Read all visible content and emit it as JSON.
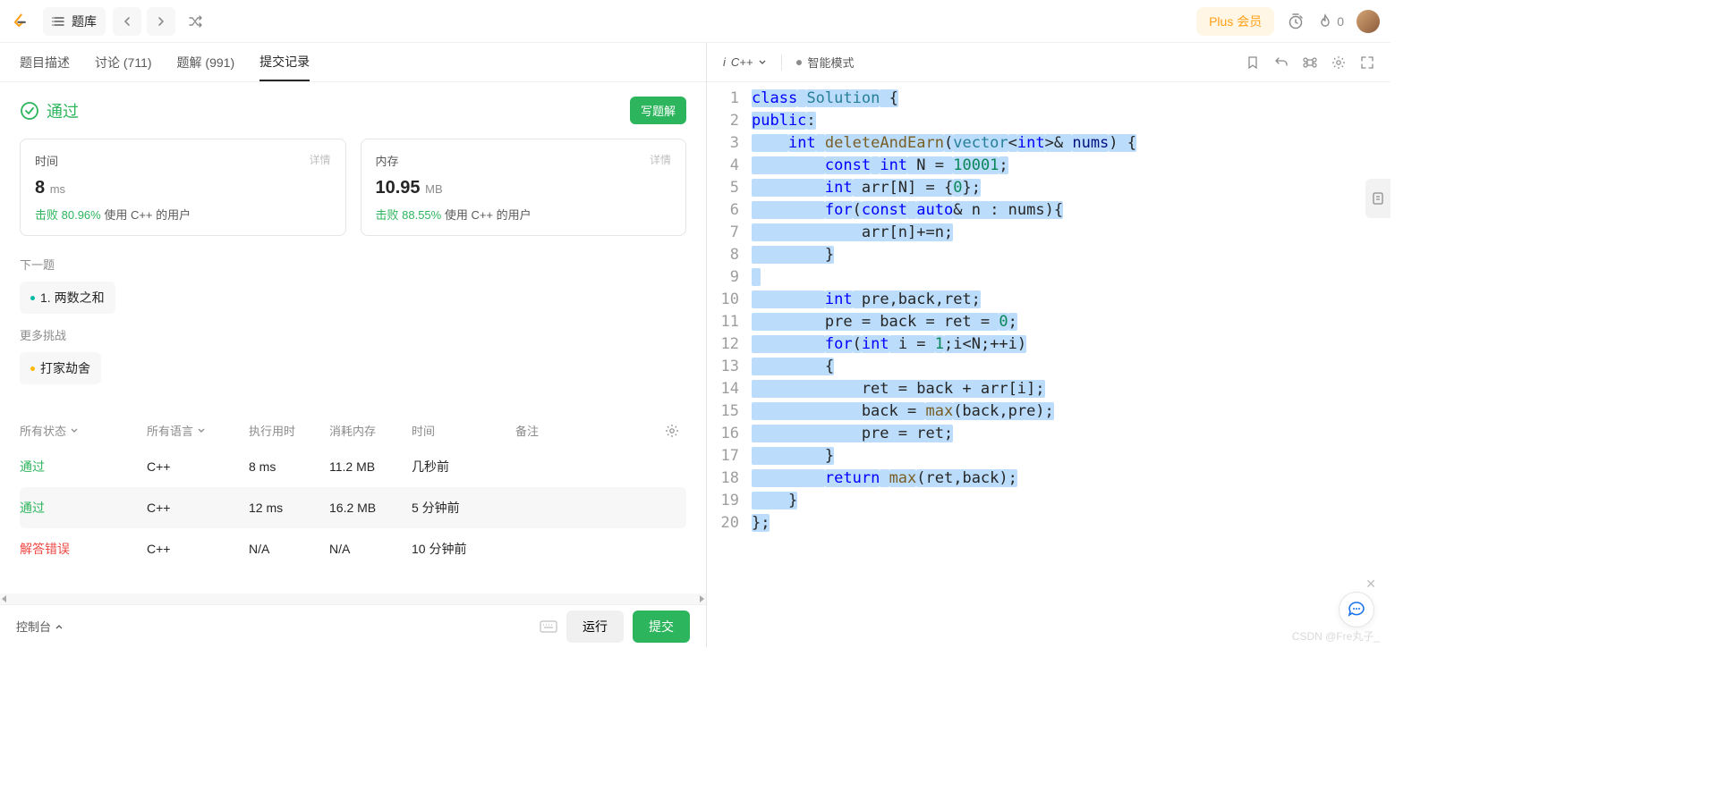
{
  "nav": {
    "problem_list_label": "题库",
    "plus_label": "Plus 会员",
    "fire_count": "0"
  },
  "tabs": {
    "desc": "题目描述",
    "discuss": "讨论 (711)",
    "solutions": "题解 (991)",
    "submissions": "提交记录"
  },
  "result": {
    "status": "通过",
    "write_solution": "写题解",
    "time_label": "时间",
    "mem_label": "内存",
    "detail": "详情",
    "time_value": "8",
    "time_unit": "ms",
    "mem_value": "10.95",
    "mem_unit": "MB",
    "time_beat_prefix": "击败 ",
    "time_beat_pct": "80.96%",
    "time_beat_suffix": " 使用 C++ 的用户",
    "mem_beat_prefix": "击败 ",
    "mem_beat_pct": "88.55%",
    "mem_beat_suffix": " 使用 C++ 的用户"
  },
  "next": {
    "label": "下一题",
    "item": "1. 两数之和"
  },
  "more": {
    "label": "更多挑战",
    "item": "打家劫舍"
  },
  "subhead": {
    "status": "所有状态",
    "lang": "所有语言",
    "runtime": "执行用时",
    "memory": "消耗内存",
    "time": "时间",
    "note": "备注"
  },
  "subs": [
    {
      "status": "通过",
      "statusClass": "status-ok",
      "lang": "C++",
      "runtime": "8 ms",
      "memory": "11.2 MB",
      "time": "几秒前"
    },
    {
      "status": "通过",
      "statusClass": "status-ok",
      "lang": "C++",
      "runtime": "12 ms",
      "memory": "16.2 MB",
      "time": "5 分钟前"
    },
    {
      "status": "解答错误",
      "statusClass": "status-err",
      "lang": "C++",
      "runtime": "N/A",
      "memory": "N/A",
      "time": "10 分钟前"
    }
  ],
  "footer": {
    "console": "控制台",
    "run": "运行",
    "submit": "提交"
  },
  "editor": {
    "lang": "C++",
    "mode": "智能模式"
  },
  "code": [
    [
      {
        "t": "class",
        "c": "kw-blue"
      },
      {
        "t": " "
      },
      {
        "t": "Solution",
        "c": "kw-teal"
      },
      {
        "t": " {"
      }
    ],
    [
      {
        "t": "public",
        "c": "kw-blue"
      },
      {
        "t": ":"
      }
    ],
    [
      {
        "t": "    "
      },
      {
        "t": "int",
        "c": "kw-blue"
      },
      {
        "t": " "
      },
      {
        "t": "deleteAndEarn",
        "c": "kw-brown"
      },
      {
        "t": "("
      },
      {
        "t": "vector",
        "c": "kw-teal"
      },
      {
        "t": "<"
      },
      {
        "t": "int",
        "c": "kw-blue"
      },
      {
        "t": ">& "
      },
      {
        "t": "nums",
        "c": "kw-darkblue"
      },
      {
        "t": ") {"
      }
    ],
    [
      {
        "t": "        "
      },
      {
        "t": "const",
        "c": "kw-blue"
      },
      {
        "t": " "
      },
      {
        "t": "int",
        "c": "kw-blue"
      },
      {
        "t": " N = "
      },
      {
        "t": "10001",
        "c": "kw-green"
      },
      {
        "t": ";"
      }
    ],
    [
      {
        "t": "        "
      },
      {
        "t": "int",
        "c": "kw-blue"
      },
      {
        "t": " arr[N] = {"
      },
      {
        "t": "0",
        "c": "kw-green"
      },
      {
        "t": "};"
      }
    ],
    [
      {
        "t": "        "
      },
      {
        "t": "for",
        "c": "kw-blue"
      },
      {
        "t": "("
      },
      {
        "t": "const",
        "c": "kw-blue"
      },
      {
        "t": " "
      },
      {
        "t": "auto",
        "c": "kw-blue"
      },
      {
        "t": "& n : nums){"
      }
    ],
    [
      {
        "t": "            arr[n]+=n;"
      }
    ],
    [
      {
        "t": "        }"
      }
    ],
    [
      {
        "t": " "
      }
    ],
    [
      {
        "t": "        "
      },
      {
        "t": "int",
        "c": "kw-blue"
      },
      {
        "t": " pre,back,ret;"
      }
    ],
    [
      {
        "t": "        pre = back = ret = "
      },
      {
        "t": "0",
        "c": "kw-green"
      },
      {
        "t": ";"
      }
    ],
    [
      {
        "t": "        "
      },
      {
        "t": "for",
        "c": "kw-blue"
      },
      {
        "t": "("
      },
      {
        "t": "int",
        "c": "kw-blue"
      },
      {
        "t": " i = "
      },
      {
        "t": "1",
        "c": "kw-green"
      },
      {
        "t": ";i<N;++i)"
      }
    ],
    [
      {
        "t": "        {"
      }
    ],
    [
      {
        "t": "            ret = back + arr[i];"
      }
    ],
    [
      {
        "t": "            back = "
      },
      {
        "t": "max",
        "c": "kw-brown"
      },
      {
        "t": "(back,pre);"
      }
    ],
    [
      {
        "t": "            pre = ret;"
      }
    ],
    [
      {
        "t": "        }"
      }
    ],
    [
      {
        "t": "        "
      },
      {
        "t": "return",
        "c": "kw-blue"
      },
      {
        "t": " "
      },
      {
        "t": "max",
        "c": "kw-brown"
      },
      {
        "t": "(ret,back);"
      }
    ],
    [
      {
        "t": "    }"
      }
    ],
    [
      {
        "t": "};"
      }
    ]
  ],
  "watermark": "CSDN @Fre丸子_"
}
